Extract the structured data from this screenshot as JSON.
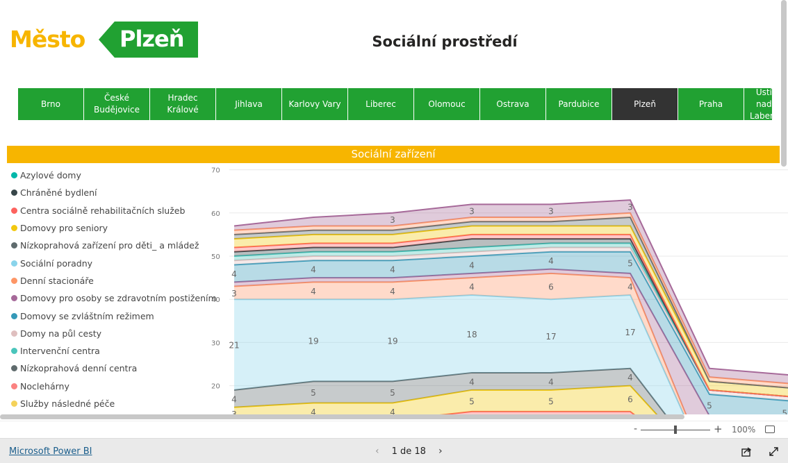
{
  "logo": {
    "text_left": "Město",
    "text_right": "Plzeň"
  },
  "header": {
    "title": "Sociální prostředí"
  },
  "tabs": [
    {
      "label": "Brno"
    },
    {
      "label": "České\nBudějovice"
    },
    {
      "label": "Hradec\nKrálové"
    },
    {
      "label": "Jihlava"
    },
    {
      "label": "Karlovy Vary"
    },
    {
      "label": "Liberec"
    },
    {
      "label": "Olomouc"
    },
    {
      "label": "Ostrava"
    },
    {
      "label": "Pardubice"
    },
    {
      "label": "Plzeň",
      "active": true
    },
    {
      "label": "Praha"
    },
    {
      "label": "Ústí nad\nLabem"
    }
  ],
  "section": {
    "title": "Sociální zařízení"
  },
  "legend": [
    {
      "label": "Azylové domy",
      "color": "#01b8aa"
    },
    {
      "label": "Chráněné bydlení",
      "color": "#374649"
    },
    {
      "label": "Centra sociálně rehabilitačních služeb",
      "color": "#fd625e"
    },
    {
      "label": "Domovy pro seniory",
      "color": "#f2c80f"
    },
    {
      "label": "Nízkoprahová zařízení pro děti_ a mládež",
      "color": "#5f6b6d"
    },
    {
      "label": "Sociální poradny",
      "color": "#8ad4eb"
    },
    {
      "label": "Denní stacionáře",
      "color": "#fe9666"
    },
    {
      "label": "Domovy pro osoby se zdravotním postižením",
      "color": "#a66999"
    },
    {
      "label": "Domovy se zvláštním režimem",
      "color": "#3599b8"
    },
    {
      "label": "Domy na půl cesty",
      "color": "#dfbfbf"
    },
    {
      "label": "Intervenční centra",
      "color": "#4ac5bb"
    },
    {
      "label": "Nízkoprahová denní centra",
      "color": "#5f6b6d"
    },
    {
      "label": "Noclehárny",
      "color": "#fb8281"
    },
    {
      "label": "Služby následné péče",
      "color": "#f4d25a"
    }
  ],
  "chart_data": {
    "type": "area",
    "stacked": true,
    "yticks": [
      20,
      30,
      40,
      50,
      60,
      70
    ],
    "ylim": [
      0,
      70
    ],
    "grid": true,
    "legend_position": "left",
    "series": [
      {
        "name": "Noclehárny",
        "color": "#fd625e",
        "values": [
          12,
          12,
          12,
          14,
          14,
          14,
          0,
          0
        ]
      },
      {
        "name": "Služby následné péče",
        "color": "#f2c80f",
        "values": [
          3,
          4,
          4,
          5,
          5,
          6,
          0,
          0
        ]
      },
      {
        "name": "Nízkoprahová denní centra",
        "color": "#5f6b6d",
        "values": [
          4,
          5,
          5,
          4,
          4,
          4,
          0,
          0
        ]
      },
      {
        "name": "Sociální poradny",
        "color": "#8ad4eb",
        "values": [
          21,
          19,
          19,
          18,
          17,
          17,
          0,
          0
        ]
      },
      {
        "name": "Denní stacionáře",
        "color": "#fe9666",
        "values": [
          3,
          4,
          4,
          4,
          6,
          4,
          0,
          0
        ]
      },
      {
        "name": "Domovy pro osoby se zdravotním postižením",
        "color": "#a66999",
        "values": [
          1,
          1,
          1,
          1,
          1,
          1,
          13,
          11
        ]
      },
      {
        "name": "Domovy se zvláštním režimem",
        "color": "#3599b8",
        "values": [
          4,
          4,
          4,
          4,
          4,
          5,
          5,
          5.5
        ]
      },
      {
        "name": "Domy na půl cesty",
        "color": "#dfbfbf",
        "values": [
          1,
          1,
          1,
          1,
          1,
          1,
          1,
          1
        ]
      },
      {
        "name": "Intervenční centra",
        "color": "#4ac5bb",
        "values": [
          1,
          1,
          1,
          1,
          1,
          1,
          0,
          0
        ]
      },
      {
        "name": "Chráněné bydlení",
        "color": "#374649",
        "values": [
          1,
          1,
          1,
          2,
          1,
          1,
          0,
          0
        ]
      },
      {
        "name": "Noclehárny",
        "color": "#fd625e",
        "values": [
          1,
          1,
          1,
          1,
          1,
          1,
          0,
          0
        ]
      },
      {
        "name": "Domovy pro seniory",
        "color": "#f2c80f",
        "values": [
          2,
          2,
          2,
          2,
          2,
          2,
          2,
          2
        ]
      },
      {
        "name": "Nízkoprahová zařízení pro děti_ a mládež",
        "color": "#5f6b6d",
        "values": [
          1,
          1,
          1,
          1,
          1,
          2,
          0,
          0
        ]
      },
      {
        "name": "Centra sociálně rehabilitačních služeb",
        "color": "#fe9666",
        "values": [
          1,
          1,
          1,
          1,
          1,
          1,
          1,
          1
        ]
      },
      {
        "name": "Azylové domy",
        "color": "#a66999",
        "values": [
          1,
          2,
          3,
          3,
          3,
          3,
          2,
          2
        ]
      }
    ]
  },
  "zoom": {
    "minus": "-",
    "plus": "+",
    "level": "100%"
  },
  "footer": {
    "brand": "Microsoft Power BI",
    "page": "1 de 18",
    "prev": "‹",
    "next": "›"
  }
}
